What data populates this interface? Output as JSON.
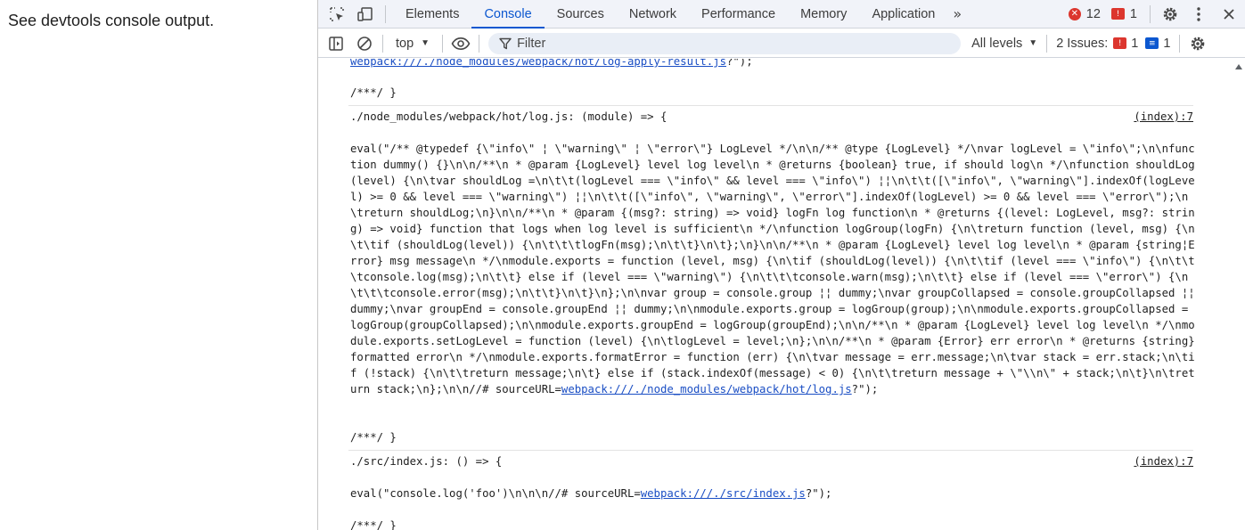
{
  "page": {
    "text": "See devtools console output."
  },
  "tabs": [
    {
      "label": "Elements",
      "active": false
    },
    {
      "label": "Console",
      "active": true
    },
    {
      "label": "Sources",
      "active": false
    },
    {
      "label": "Network",
      "active": false
    },
    {
      "label": "Performance",
      "active": false
    },
    {
      "label": "Memory",
      "active": false
    },
    {
      "label": "Application",
      "active": false
    }
  ],
  "tabbar": {
    "more": "»",
    "error_count": "12",
    "issue_count": "1"
  },
  "toolbar": {
    "context": "top",
    "filter_placeholder": "Filter",
    "levels": "All levels",
    "issues_label": "2 Issues:",
    "issues_error": "1",
    "issues_info": "1"
  },
  "console": {
    "top_partial_url": "webpack:///./node_modules/webpack/hot/log-apply-result.js",
    "top_partial_tail": "?\");",
    "end_marker": "/***/ }",
    "modules": [
      {
        "header": "./node_modules/webpack/hot/log.js: (module) => {",
        "source": "(index):7",
        "code": "eval(\"/** @typedef {\\\"info\\\" ¦ \\\"warning\\\" ¦ \\\"error\\\"} LogLevel */\\n\\n/** @type {LogLevel} */\\nvar logLevel = \\\"info\\\";\\n\\nfunction dummy() {}\\n\\n/**\\n * @param {LogLevel} level log level\\n * @returns {boolean} true, if should log\\n */\\nfunction shouldLog(level) {\\n\\tvar shouldLog =\\n\\t\\t(logLevel === \\\"info\\\" && level === \\\"info\\\") ¦¦\\n\\t\\t([\\\"info\\\", \\\"warning\\\"].indexOf(logLevel) >= 0 && level === \\\"warning\\\") ¦¦\\n\\t\\t([\\\"info\\\", \\\"warning\\\", \\\"error\\\"].indexOf(logLevel) >= 0 && level === \\\"error\\\");\\n\\treturn shouldLog;\\n}\\n\\n/**\\n * @param {(msg?: string) => void} logFn log function\\n * @returns {(level: LogLevel, msg?: string) => void} function that logs when log level is sufficient\\n */\\nfunction logGroup(logFn) {\\n\\treturn function (level, msg) {\\n\\t\\tif (shouldLog(level)) {\\n\\t\\t\\tlogFn(msg);\\n\\t\\t}\\n\\t};\\n}\\n\\n/**\\n * @param {LogLevel} level log level\\n * @param {string¦Error} msg message\\n */\\nmodule.exports = function (level, msg) {\\n\\tif (shouldLog(level)) {\\n\\t\\tif (level === \\\"info\\\") {\\n\\t\\t\\tconsole.log(msg);\\n\\t\\t} else if (level === \\\"warning\\\") {\\n\\t\\t\\tconsole.warn(msg);\\n\\t\\t} else if (level === \\\"error\\\") {\\n\\t\\t\\tconsole.error(msg);\\n\\t\\t}\\n\\t}\\n};\\n\\nvar group = console.group ¦¦ dummy;\\nvar groupCollapsed = console.groupCollapsed ¦¦ dummy;\\nvar groupEnd = console.groupEnd ¦¦ dummy;\\n\\nmodule.exports.group = logGroup(group);\\n\\nmodule.exports.groupCollapsed = logGroup(groupCollapsed);\\n\\nmodule.exports.groupEnd = logGroup(groupEnd);\\n\\n/**\\n * @param {LogLevel} level log level\\n */\\nmodule.exports.setLogLevel = function (level) {\\n\\tlogLevel = level;\\n};\\n\\n/**\\n * @param {Error} err error\\n * @returns {string} formatted error\\n */\\nmodule.exports.formatError = function (err) {\\n\\tvar message = err.message;\\n\\tvar stack = err.stack;\\n\\tif (!stack) {\\n\\t\\treturn message;\\n\\t} else if (stack.indexOf(message) < 0) {\\n\\t\\treturn message + \\\"\\\\n\\\" + stack;\\n\\t}\\n\\treturn stack;\\n};\\n\\n//# sourceURL=",
        "url": "webpack:///./node_modules/webpack/hot/log.js",
        "tail": "?\");"
      },
      {
        "header": "./src/index.js: () => {",
        "source": "(index):7",
        "code": "eval(\"console.log('foo')\\n\\n\\n//# sourceURL=",
        "url": "webpack:///./src/index.js",
        "tail": "?\");"
      }
    ]
  }
}
